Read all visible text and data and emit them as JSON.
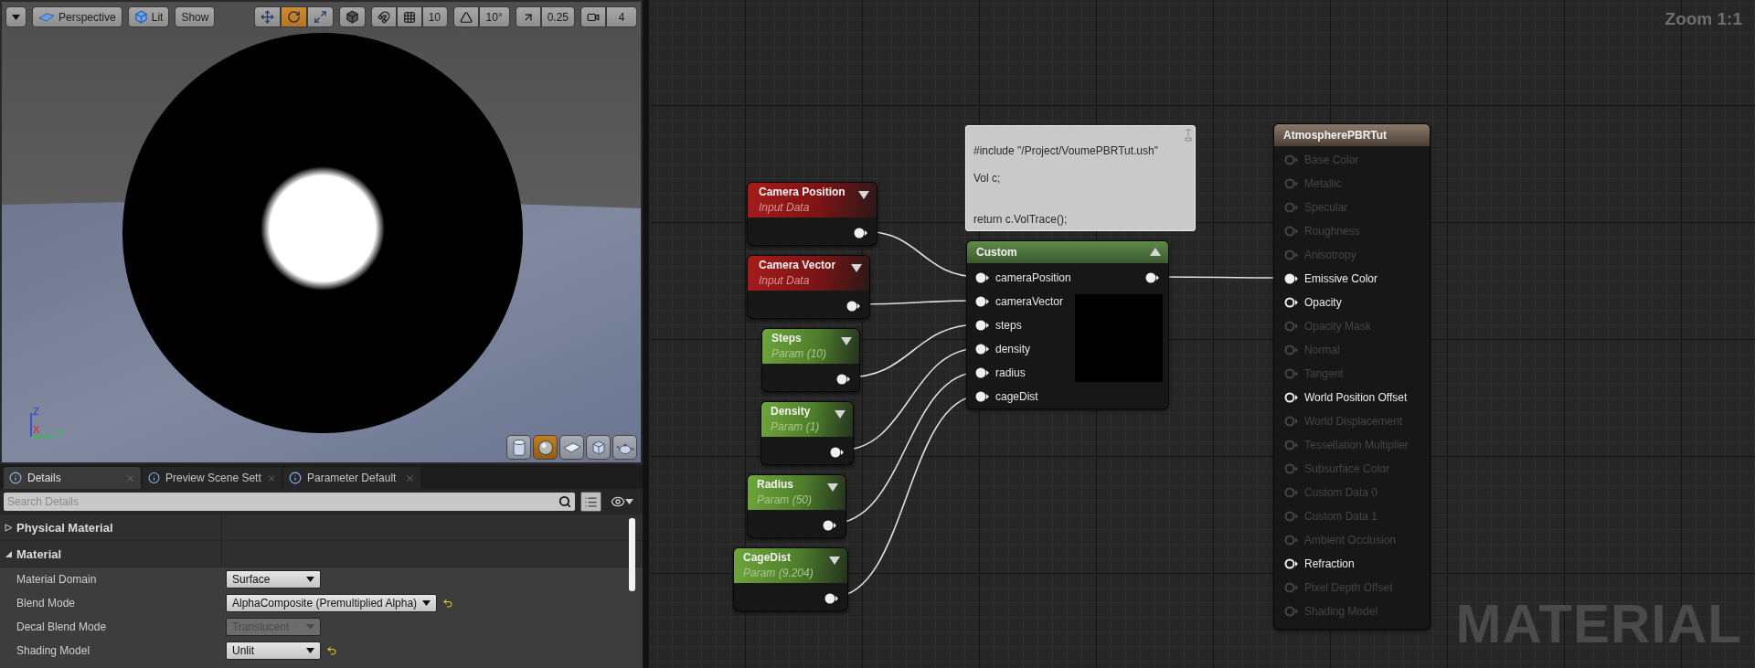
{
  "viewport": {
    "view_buttons": [
      {
        "kind": "perspective",
        "label": "Perspective"
      },
      {
        "kind": "lit",
        "label": "Lit"
      },
      {
        "kind": "plain",
        "label": "Show"
      }
    ],
    "transform_tools": [
      {
        "kind": "move",
        "selected": false
      },
      {
        "kind": "rotate",
        "selected": true
      },
      {
        "kind": "scale",
        "selected": false
      }
    ],
    "snap_settings": [
      {
        "kind": "grid",
        "value": "10"
      },
      {
        "kind": "angle",
        "value": "10°"
      },
      {
        "kind": "scale",
        "value": "0.25"
      },
      {
        "kind": "camera_speed",
        "value": "4"
      }
    ],
    "axis_labels": [
      "Z",
      "X",
      "Y"
    ],
    "preview_shapes": [
      {
        "kind": "cylinder",
        "selected": false
      },
      {
        "kind": "sphere",
        "selected": true
      },
      {
        "kind": "plane",
        "selected": false
      },
      {
        "kind": "cube",
        "selected": false
      },
      {
        "kind": "mesh",
        "selected": false
      }
    ]
  },
  "details": {
    "tabs": [
      {
        "label": "Details",
        "selected": true
      },
      {
        "label": "Preview Scene Sett",
        "selected": false
      },
      {
        "label": "Parameter Default",
        "selected": false
      }
    ],
    "search": {
      "placeholder": "Search Details"
    },
    "categories": [
      {
        "label": "Physical Material",
        "expanded": false
      },
      {
        "label": "Material",
        "expanded": true,
        "properties": [
          {
            "name": "Material Domain",
            "value": "Surface",
            "disabled": false,
            "modified": false
          },
          {
            "name": "Blend Mode",
            "value": "AlphaComposite (Premultiplied Alpha)",
            "disabled": false,
            "modified": true
          },
          {
            "name": "Decal Blend Mode",
            "value": "Translucent",
            "disabled": true,
            "modified": false
          },
          {
            "name": "Shading Model",
            "value": "Unlit",
            "disabled": false,
            "modified": true
          }
        ]
      }
    ]
  },
  "graph": {
    "zoom_label": "Zoom 1:1",
    "watermark": "MATERIAL",
    "comment": {
      "text": "#include \"/Project/VoumePBRTut.ush\"\n\nVol c;\n\n\nreturn c.VolTrace();"
    },
    "input_nodes": [
      {
        "kind": "input",
        "title": "Camera Position",
        "subtitle": "Input Data"
      },
      {
        "kind": "input",
        "title": "Camera Vector",
        "subtitle": "Input Data"
      },
      {
        "kind": "param",
        "title": "Steps",
        "subtitle": "Param (10)"
      },
      {
        "kind": "param",
        "title": "Density",
        "subtitle": "Param (1)"
      },
      {
        "kind": "param",
        "title": "Radius",
        "subtitle": "Param (50)"
      },
      {
        "kind": "param",
        "title": "CageDist",
        "subtitle": "Param (9.204)"
      }
    ],
    "custom_node": {
      "title": "Custom",
      "inputs": [
        "cameraPosition",
        "cameraVector",
        "steps",
        "density",
        "radius",
        "cageDist"
      ]
    },
    "result_node": {
      "title": "AtmospherePBRTut",
      "pins": [
        {
          "label": "Base Color",
          "enabled": false,
          "connected": false
        },
        {
          "label": "Metallic",
          "enabled": false,
          "connected": false
        },
        {
          "label": "Specular",
          "enabled": false,
          "connected": false
        },
        {
          "label": "Roughness",
          "enabled": false,
          "connected": false
        },
        {
          "label": "Anisotropy",
          "enabled": false,
          "connected": false
        },
        {
          "label": "Emissive Color",
          "enabled": true,
          "connected": true
        },
        {
          "label": "Opacity",
          "enabled": true,
          "connected": false
        },
        {
          "label": "Opacity Mask",
          "enabled": false,
          "connected": false
        },
        {
          "label": "Normal",
          "enabled": false,
          "connected": false
        },
        {
          "label": "Tangent",
          "enabled": false,
          "connected": false
        },
        {
          "label": "World Position Offset",
          "enabled": true,
          "connected": false
        },
        {
          "label": "World Displacement",
          "enabled": false,
          "connected": false
        },
        {
          "label": "Tessellation Multiplier",
          "enabled": false,
          "connected": false
        },
        {
          "label": "Subsurface Color",
          "enabled": false,
          "connected": false
        },
        {
          "label": "Custom Data 0",
          "enabled": false,
          "connected": false
        },
        {
          "label": "Custom Data 1",
          "enabled": false,
          "connected": false
        },
        {
          "label": "Ambient Occlusion",
          "enabled": false,
          "connected": false
        },
        {
          "label": "Refraction",
          "enabled": true,
          "connected": false
        },
        {
          "label": "Pixel Depth Offset",
          "enabled": false,
          "connected": false
        },
        {
          "label": "Shading Model",
          "enabled": false,
          "connected": false
        }
      ]
    }
  }
}
